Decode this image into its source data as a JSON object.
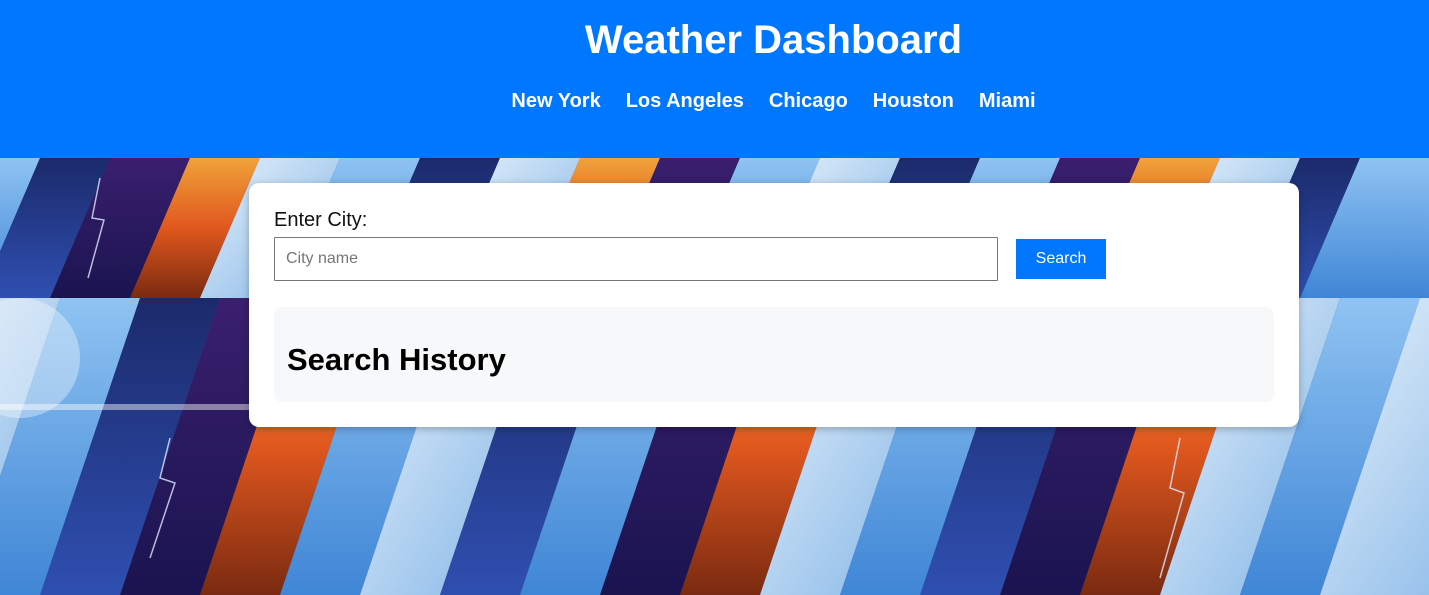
{
  "header": {
    "title": "Weather Dashboard",
    "nav": [
      {
        "label": "New York"
      },
      {
        "label": "Los Angeles"
      },
      {
        "label": "Chicago"
      },
      {
        "label": "Houston"
      },
      {
        "label": "Miami"
      }
    ]
  },
  "search": {
    "label": "Enter City:",
    "placeholder": "City name",
    "value": "",
    "button_label": "Search"
  },
  "history": {
    "title": "Search History"
  },
  "colors": {
    "accent": "#0077ff",
    "history_bg": "#f6f8fa",
    "card_bg": "#ffffff"
  }
}
